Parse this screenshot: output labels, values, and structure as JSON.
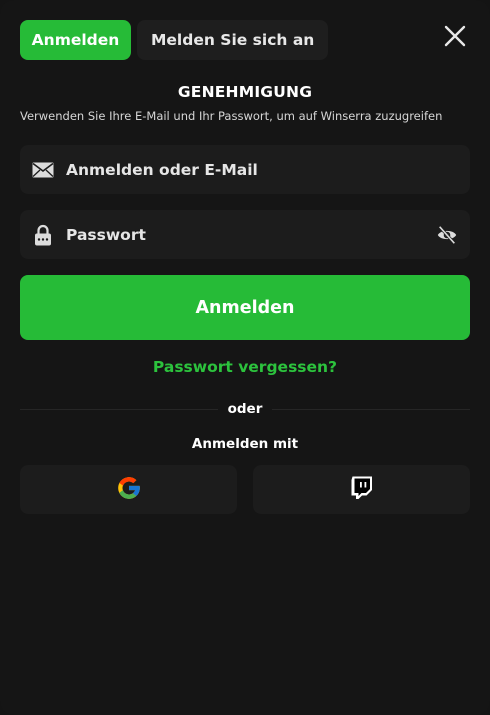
{
  "tabs": [
    {
      "label": "Anmelden",
      "active": true
    },
    {
      "label": "Melden Sie sich an",
      "active": false
    }
  ],
  "close_icon": "close-icon",
  "heading": "GENEHMIGUNG",
  "subtitle": "Verwenden Sie Ihre E-Mail und Ihr Passwort, um auf Winserra zuzugreifen",
  "fields": {
    "email": {
      "placeholder": "Anmelden oder E-Mail",
      "value": "",
      "icon": "envelope-icon"
    },
    "password": {
      "placeholder": "Passwort",
      "value": "",
      "icon": "lock-icon",
      "toggle_icon": "eye-slash-icon"
    }
  },
  "submit_label": "Anmelden",
  "forgot_label": "Passwort vergessen?",
  "divider_label": "oder",
  "social_label": "Anmelden mit",
  "social_buttons": [
    {
      "icon": "google-icon"
    },
    {
      "icon": "twitch-icon"
    }
  ],
  "colors": {
    "accent": "#26bb37",
    "background": "#151515",
    "field": "#1c1c1c"
  }
}
